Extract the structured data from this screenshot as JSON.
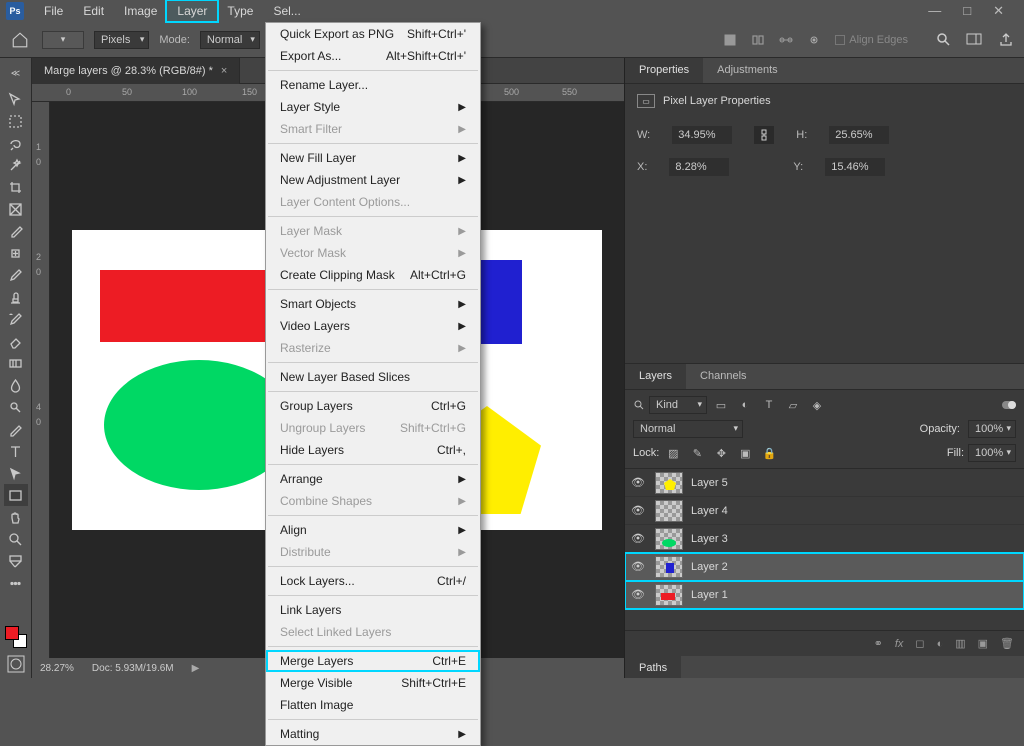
{
  "menubar": {
    "items": [
      "File",
      "Edit",
      "Image",
      "Layer",
      "Type",
      "Sel..."
    ],
    "highlighted_index": 3
  },
  "options": {
    "unit": "Pixels",
    "mode_label": "Mode:",
    "mode_value": "Normal",
    "align_edges": "Align Edges"
  },
  "doc": {
    "tab_title": "Marge layers @ 28.3% (RGB/8#) *",
    "status_zoom": "28.27%",
    "status_doc": "Doc: 5.93M/19.6M",
    "ruler_ticks_h": [
      "0",
      "50",
      "100",
      "150",
      "500",
      "550"
    ],
    "ruler_ticks_v": [
      "1",
      "0",
      "2",
      "0",
      "4",
      "0"
    ]
  },
  "layer_menu": [
    {
      "label": "Quick Export as PNG",
      "shortcut": "Shift+Ctrl+'"
    },
    {
      "label": "Export As...",
      "shortcut": "Alt+Shift+Ctrl+'"
    },
    {
      "sep": true
    },
    {
      "label": "Rename Layer..."
    },
    {
      "label": "Layer Style",
      "submenu": true
    },
    {
      "label": "Smart Filter",
      "submenu": true,
      "disabled": true
    },
    {
      "sep": true
    },
    {
      "label": "New Fill Layer",
      "submenu": true
    },
    {
      "label": "New Adjustment Layer",
      "submenu": true
    },
    {
      "label": "Layer Content Options...",
      "disabled": true
    },
    {
      "sep": true
    },
    {
      "label": "Layer Mask",
      "submenu": true,
      "disabled": true
    },
    {
      "label": "Vector Mask",
      "submenu": true,
      "disabled": true
    },
    {
      "label": "Create Clipping Mask",
      "shortcut": "Alt+Ctrl+G"
    },
    {
      "sep": true
    },
    {
      "label": "Smart Objects",
      "submenu": true
    },
    {
      "label": "Video Layers",
      "submenu": true
    },
    {
      "label": "Rasterize",
      "submenu": true,
      "disabled": true
    },
    {
      "sep": true
    },
    {
      "label": "New Layer Based Slices"
    },
    {
      "sep": true
    },
    {
      "label": "Group Layers",
      "shortcut": "Ctrl+G"
    },
    {
      "label": "Ungroup Layers",
      "shortcut": "Shift+Ctrl+G",
      "disabled": true
    },
    {
      "label": "Hide Layers",
      "shortcut": "Ctrl+,"
    },
    {
      "sep": true
    },
    {
      "label": "Arrange",
      "submenu": true
    },
    {
      "label": "Combine Shapes",
      "submenu": true,
      "disabled": true
    },
    {
      "sep": true
    },
    {
      "label": "Align",
      "submenu": true
    },
    {
      "label": "Distribute",
      "submenu": true,
      "disabled": true
    },
    {
      "sep": true
    },
    {
      "label": "Lock Layers...",
      "shortcut": "Ctrl+/"
    },
    {
      "sep": true
    },
    {
      "label": "Link Layers"
    },
    {
      "label": "Select Linked Layers",
      "disabled": true
    },
    {
      "sep": true
    },
    {
      "label": "Merge Layers",
      "shortcut": "Ctrl+E",
      "highlighted": true
    },
    {
      "label": "Merge Visible",
      "shortcut": "Shift+Ctrl+E"
    },
    {
      "label": "Flatten Image"
    },
    {
      "sep": true
    },
    {
      "label": "Matting",
      "submenu": true
    }
  ],
  "properties": {
    "tab_properties": "Properties",
    "tab_adjustments": "Adjustments",
    "title": "Pixel Layer Properties",
    "w_label": "W:",
    "w_value": "34.95%",
    "h_label": "H:",
    "h_value": "25.65%",
    "x_label": "X:",
    "x_value": "8.28%",
    "y_label": "Y:",
    "y_value": "15.46%"
  },
  "layers_panel": {
    "tab_layers": "Layers",
    "tab_channels": "Channels",
    "kind": "Kind",
    "blend": "Normal",
    "opacity_label": "Opacity:",
    "opacity_value": "100%",
    "lock_label": "Lock:",
    "fill_label": "Fill:",
    "fill_value": "100%",
    "layers": [
      {
        "name": "Layer 5",
        "thumb": "pentagon"
      },
      {
        "name": "Layer 4",
        "thumb": "blank"
      },
      {
        "name": "Layer 3",
        "thumb": "ellipse"
      },
      {
        "name": "Layer 2",
        "thumb": "blue",
        "selected": true
      },
      {
        "name": "Layer 1",
        "thumb": "red",
        "selected": true
      }
    ]
  },
  "paths_tab": "Paths",
  "tools": [
    "move",
    "marquee",
    "lasso",
    "magic-wand",
    "crop",
    "frame",
    "eyedropper",
    "heal",
    "brush",
    "stamp",
    "history-brush",
    "eraser",
    "gradient",
    "blur",
    "dodge",
    "pen",
    "type",
    "path-select",
    "rectangle",
    "hand",
    "zoom",
    "3d",
    "dots"
  ]
}
